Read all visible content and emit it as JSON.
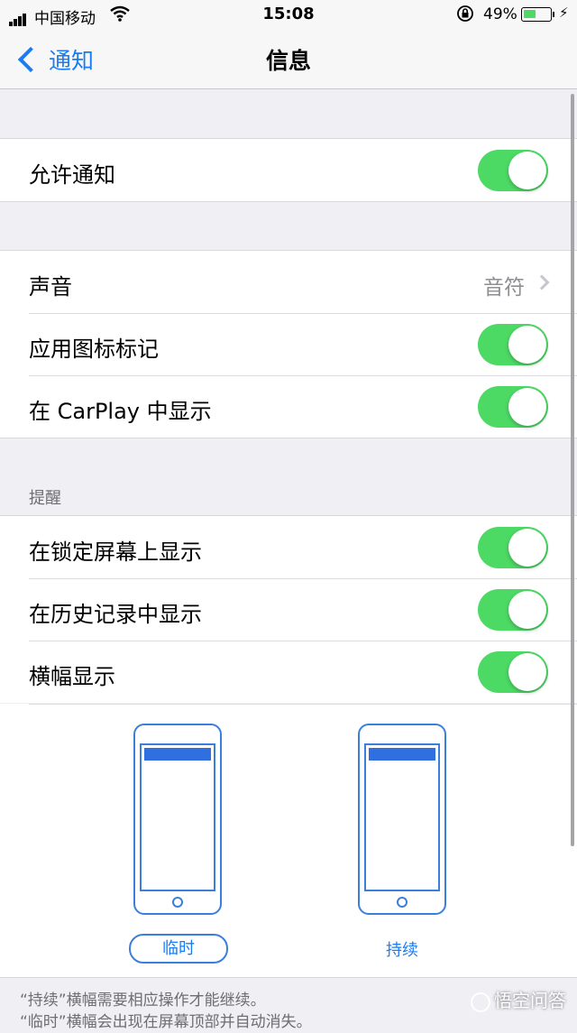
{
  "status_bar": {
    "carrier": "中国移动",
    "time": "15:08",
    "battery_percent": "49%",
    "battery_level": 0.49,
    "icons": [
      "cellular-signal-icon",
      "wifi-icon",
      "orientation-lock-icon",
      "battery-icon",
      "charging-bolt-icon"
    ]
  },
  "nav": {
    "back_label": "通知",
    "title": "信息"
  },
  "allow_notifications": {
    "label": "允许通知",
    "on": true
  },
  "main": {
    "sound_label": "声音",
    "sound_value": "音符",
    "badge_label": "应用图标标记",
    "badge_on": true,
    "carplay_label": "在 CarPlay 中显示",
    "carplay_on": true
  },
  "alerts": {
    "header": "提醒",
    "lock_screen_label": "在锁定屏幕上显示",
    "lock_screen_on": true,
    "history_label": "在历史记录中显示",
    "history_on": true,
    "banners_label": "横幅显示",
    "banners_on": true
  },
  "banner_style": {
    "temporary_label": "临时",
    "persistent_label": "持续",
    "selected": "临时"
  },
  "footer": {
    "line1": "“持续”横幅需要相应操作才能继续。",
    "line2": "“临时”横幅会出现在屏幕顶部并自动消失。"
  },
  "watermark": "悟空问答",
  "colors": {
    "accent": "#1a7cf5",
    "toggle_on": "#4cd964",
    "background": "#efeff4"
  }
}
